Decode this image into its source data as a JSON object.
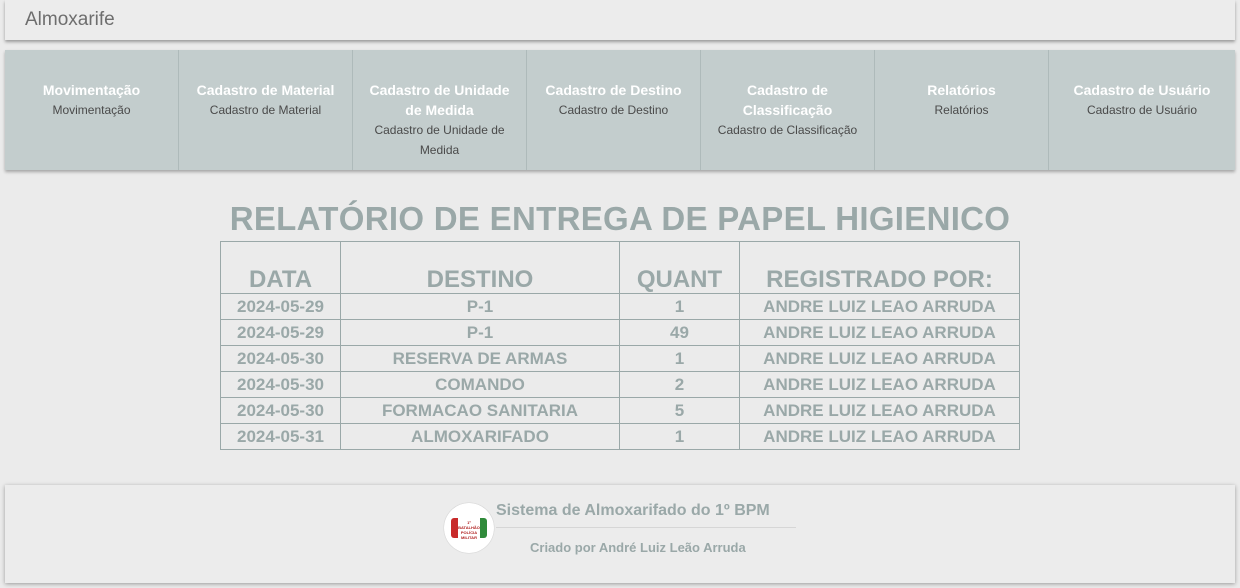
{
  "app": {
    "brand": "Almoxarife"
  },
  "nav": {
    "items": [
      {
        "title": "Movimentação",
        "subtitle": "Movimentação"
      },
      {
        "title": "Cadastro de Material",
        "subtitle": "Cadastro de Material"
      },
      {
        "title": "Cadastro de Unidade de Medida",
        "subtitle": "Cadastro de Unidade de Medida"
      },
      {
        "title": "Cadastro de Destino",
        "subtitle": "Cadastro de Destino"
      },
      {
        "title": "Cadastro de Classificação",
        "subtitle": "Cadastro de Classificação"
      },
      {
        "title": "Relatórios",
        "subtitle": "Relatórios"
      },
      {
        "title": "Cadastro de Usuário",
        "subtitle": "Cadastro de Usuário"
      }
    ]
  },
  "report": {
    "title": "RELATÓRIO DE ENTREGA DE PAPEL HIGIENICO",
    "headers": [
      "DATA",
      "DESTINO",
      "QUANT",
      "REGISTRADO POR:"
    ],
    "rows": [
      [
        "2024-05-29",
        "P-1",
        "1",
        "ANDRE LUIZ LEAO ARRUDA"
      ],
      [
        "2024-05-29",
        "P-1",
        "49",
        "ANDRE LUIZ LEAO ARRUDA"
      ],
      [
        "2024-05-30",
        "RESERVA DE ARMAS",
        "1",
        "ANDRE LUIZ LEAO ARRUDA"
      ],
      [
        "2024-05-30",
        "COMANDO",
        "2",
        "ANDRE LUIZ LEAO ARRUDA"
      ],
      [
        "2024-05-30",
        "FORMACAO SANITARIA",
        "5",
        "ANDRE LUIZ LEAO ARRUDA"
      ],
      [
        "2024-05-31",
        "ALMOXARIFADO",
        "1",
        "ANDRE LUIZ LEAO ARRUDA"
      ]
    ]
  },
  "footer": {
    "logo_text": "1º BATALHÃO POLÍCIA MILITAR",
    "title": "Sistema de Almoxarifado do 1º BPM",
    "credit": "Criado por André Luiz Leão Arruda"
  }
}
